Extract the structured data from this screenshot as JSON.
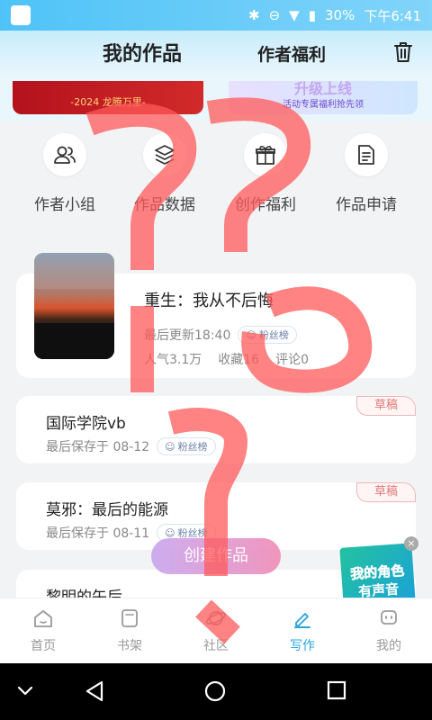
{
  "status_bar": {
    "battery": "30%",
    "time": "下午6:41",
    "icons": [
      "bluetooth-icon",
      "dnd-icon",
      "wifi-icon",
      "battery-icon"
    ]
  },
  "header": {
    "tab_my_works": "我的作品",
    "tab_author_welfare": "作者福利",
    "trash_icon": "trash-icon"
  },
  "banners": [
    {
      "text": "-2024 龙腾万里-"
    },
    {
      "title": "升级上线",
      "subtitle": "活动专属福利抢先领"
    }
  ],
  "quick_actions": [
    {
      "label": "作者小组",
      "icon": "group-icon"
    },
    {
      "label": "作品数据",
      "icon": "layers-icon"
    },
    {
      "label": "创作福利",
      "icon": "gift-icon"
    },
    {
      "label": "作品申请",
      "icon": "document-icon"
    }
  ],
  "featured_work": {
    "title": "重生：我从不后悔",
    "last_update": "最后更新18:40",
    "badge": "粉丝榜",
    "popularity": "人气3.1万",
    "favorites": "收藏16",
    "comments": "评论0"
  },
  "drafts": [
    {
      "title": "国际学院vb",
      "saved": "最后保存于 08-12",
      "badge": "粉丝榜",
      "tag": "草稿"
    },
    {
      "title": "莫邪：最后的能源",
      "saved": "最后保存于 08-11",
      "badge": "粉丝榜",
      "tag": "草稿"
    },
    {
      "title": "黎明的午后"
    }
  ],
  "create_button": "创建作品",
  "voice_ad": {
    "line1": "我的角色",
    "line2": "有声音",
    "close": "×"
  },
  "bottom_nav": [
    {
      "label": "首页",
      "icon": "home-icon"
    },
    {
      "label": "书架",
      "icon": "bookshelf-icon"
    },
    {
      "label": "社区",
      "icon": "planet-icon"
    },
    {
      "label": "写作",
      "icon": "pen-icon",
      "active": true
    },
    {
      "label": "我的",
      "icon": "profile-icon"
    }
  ],
  "colors": {
    "accent": "#2aa4dc",
    "draft_tag": "#e07a7a",
    "scribble": "#ff5a5a"
  }
}
